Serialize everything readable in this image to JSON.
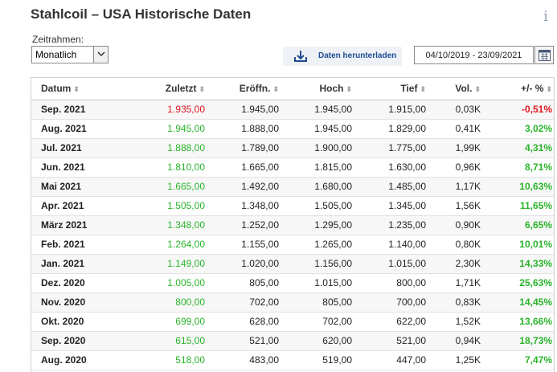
{
  "header": {
    "title": "Stahlcoil – USA Historische Daten",
    "info_icon": "i"
  },
  "timeframe": {
    "label": "Zeitrahmen:",
    "value": "Monatlich"
  },
  "download": {
    "label": "Daten herunterladen"
  },
  "daterange": {
    "value": "04/10/2019 - 23/09/2021"
  },
  "colors": {
    "up": "#2ab42a",
    "down": "#e0141e",
    "link": "#1f4d93"
  },
  "table": {
    "columns": [
      "Datum",
      "Zuletzt",
      "Eröffn.",
      "Hoch",
      "Tief",
      "Vol.",
      "+/- %"
    ],
    "rows": [
      {
        "date": "Sep. 2021",
        "last": "1.935,00",
        "open": "1.945,00",
        "high": "1.945,00",
        "low": "1.915,00",
        "vol": "0,03K",
        "chg": "-0,51%",
        "dir": "down"
      },
      {
        "date": "Aug. 2021",
        "last": "1.945,00",
        "open": "1.888,00",
        "high": "1.945,00",
        "low": "1.829,00",
        "vol": "0,41K",
        "chg": "3,02%",
        "dir": "up"
      },
      {
        "date": "Jul. 2021",
        "last": "1.888,00",
        "open": "1.789,00",
        "high": "1.900,00",
        "low": "1.775,00",
        "vol": "1,99K",
        "chg": "4,31%",
        "dir": "up"
      },
      {
        "date": "Jun. 2021",
        "last": "1.810,00",
        "open": "1.665,00",
        "high": "1.815,00",
        "low": "1.630,00",
        "vol": "0,96K",
        "chg": "8,71%",
        "dir": "up"
      },
      {
        "date": "Mai 2021",
        "last": "1.665,00",
        "open": "1.492,00",
        "high": "1.680,00",
        "low": "1.485,00",
        "vol": "1,17K",
        "chg": "10,63%",
        "dir": "up"
      },
      {
        "date": "Apr. 2021",
        "last": "1.505,00",
        "open": "1.348,00",
        "high": "1.505,00",
        "low": "1.345,00",
        "vol": "1,56K",
        "chg": "11,65%",
        "dir": "up"
      },
      {
        "date": "März 2021",
        "last": "1.348,00",
        "open": "1.252,00",
        "high": "1.295,00",
        "low": "1.235,00",
        "vol": "0,90K",
        "chg": "6,65%",
        "dir": "up"
      },
      {
        "date": "Feb. 2021",
        "last": "1.264,00",
        "open": "1.155,00",
        "high": "1.265,00",
        "low": "1.140,00",
        "vol": "0,80K",
        "chg": "10,01%",
        "dir": "up"
      },
      {
        "date": "Jan. 2021",
        "last": "1.149,00",
        "open": "1.020,00",
        "high": "1.156,00",
        "low": "1.015,00",
        "vol": "2,30K",
        "chg": "14,33%",
        "dir": "up"
      },
      {
        "date": "Dez. 2020",
        "last": "1.005,00",
        "open": "805,00",
        "high": "1.015,00",
        "low": "800,00",
        "vol": "1,71K",
        "chg": "25,63%",
        "dir": "up"
      },
      {
        "date": "Nov. 2020",
        "last": "800,00",
        "open": "702,00",
        "high": "805,00",
        "low": "700,00",
        "vol": "0,83K",
        "chg": "14,45%",
        "dir": "up"
      },
      {
        "date": "Okt. 2020",
        "last": "699,00",
        "open": "628,00",
        "high": "702,00",
        "low": "622,00",
        "vol": "1,52K",
        "chg": "13,66%",
        "dir": "up"
      },
      {
        "date": "Sep. 2020",
        "last": "615,00",
        "open": "521,00",
        "high": "620,00",
        "low": "521,00",
        "vol": "0,94K",
        "chg": "18,73%",
        "dir": "up"
      },
      {
        "date": "Aug. 2020",
        "last": "518,00",
        "open": "483,00",
        "high": "519,00",
        "low": "447,00",
        "vol": "1,25K",
        "chg": "7,47%",
        "dir": "up"
      }
    ]
  }
}
